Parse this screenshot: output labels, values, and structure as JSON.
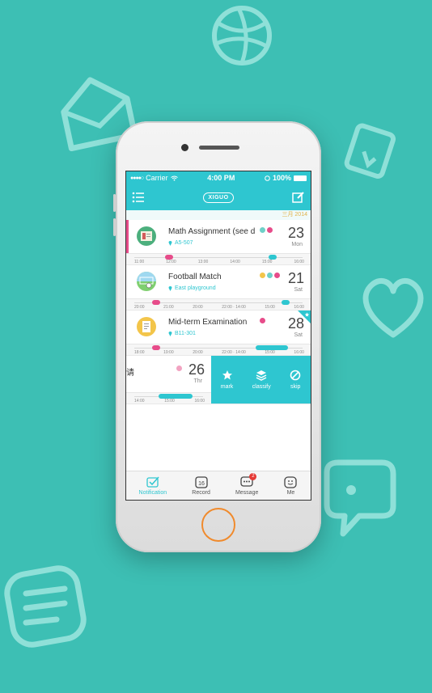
{
  "status": {
    "carrier": "Carrier",
    "time": "4:00 PM",
    "battery": "100%"
  },
  "nav": {
    "logo": "XIGUO"
  },
  "date_header": "三月 2014",
  "cards": [
    {
      "title": "Math Assignment (see d",
      "location": "A5-507",
      "day": "23",
      "weekday": "Mon",
      "ticks": [
        "11:00",
        "12:00",
        "13:00",
        "14:00",
        "15:00",
        "16:00"
      ]
    },
    {
      "title": "Football Match",
      "location": "East playground",
      "day": "21",
      "weekday": "Sat",
      "ticks": [
        "20:00",
        "21:00",
        "20:00",
        "22:00 · 14:00",
        "15:00",
        "16:00"
      ]
    },
    {
      "title": "Mid-term Examination",
      "location": "B11-301",
      "day": "28",
      "weekday": "Sat",
      "ticks": [
        "18:00",
        "19:00",
        "20:00",
        "22:00 · 14:00",
        "15:00",
        "16:00"
      ]
    }
  ],
  "swipe_card": {
    "title": "请",
    "day": "26",
    "weekday": "Thr",
    "ticks": [
      "14:00",
      "15:00",
      "16:00"
    ]
  },
  "actions": [
    {
      "label": "mark",
      "icon": "star-icon"
    },
    {
      "label": "classify",
      "icon": "layers-icon"
    },
    {
      "label": "skip",
      "icon": "skip-icon"
    }
  ],
  "tabs": [
    {
      "label": "Notification",
      "icon": "notification-icon"
    },
    {
      "label": "Record",
      "icon": "calendar-icon",
      "icon_text": "16"
    },
    {
      "label": "Message",
      "icon": "message-icon",
      "badge": "2"
    },
    {
      "label": "Me",
      "icon": "profile-icon"
    }
  ],
  "colors": {
    "background": "#3dbfb4",
    "accent": "#2ec6d0",
    "pink": "#e74c8a",
    "home_ring": "#f08a2c"
  }
}
